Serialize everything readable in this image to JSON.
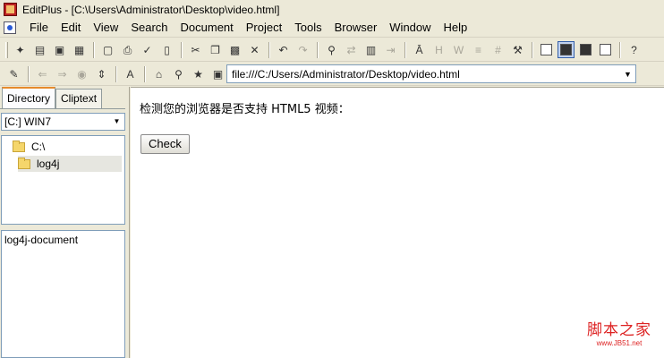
{
  "window": {
    "title": "EditPlus - [C:\\Users\\Administrator\\Desktop\\video.html]"
  },
  "menu": [
    "File",
    "Edit",
    "View",
    "Search",
    "Document",
    "Project",
    "Tools",
    "Browser",
    "Window",
    "Help"
  ],
  "toolbar": {
    "address": "file:///C:/Users/Administrator/Desktop/video.html"
  },
  "sidebar": {
    "tabs": [
      "Directory",
      "Cliptext"
    ],
    "drive": "[C:] WIN7",
    "tree": [
      "C:\\",
      "log4j"
    ],
    "files": [
      "log4j-document"
    ]
  },
  "content": {
    "heading": "检测您的浏览器是否支持 HTML5 视频：",
    "button": "Check"
  },
  "watermark": {
    "main": "脚本之家",
    "sub": "www.JB51.net"
  },
  "colors": {
    "chrome": "#ece9d8",
    "tab_accent": "#e68b2c",
    "watermark": "#dd2222"
  }
}
